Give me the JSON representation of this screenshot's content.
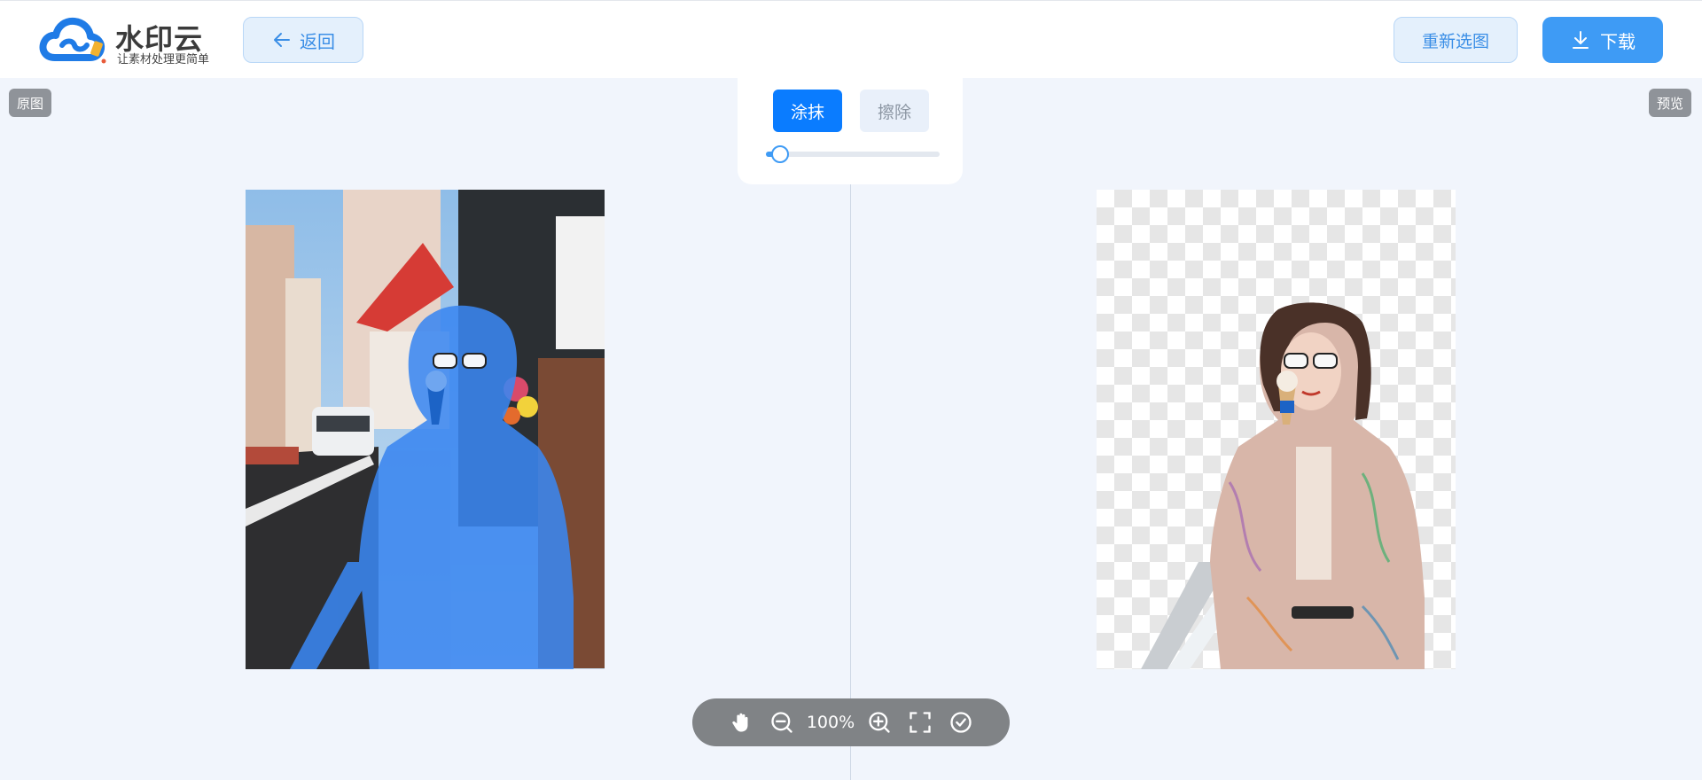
{
  "header": {
    "logo_title": "水印云",
    "logo_subtitle": "让素材处理更简单",
    "back_label": "返回",
    "reselect_label": "重新选图",
    "download_label": "下载"
  },
  "labels": {
    "original": "原图",
    "preview": "预览"
  },
  "tools": {
    "paint_label": "涂抹",
    "erase_label": "擦除",
    "brush_size_fraction": 0.05
  },
  "zoom": {
    "level": "100%"
  },
  "colors": {
    "accent": "#3e9bf5",
    "paint_active": "#0a7cff",
    "mask_blue": "#3a86f0"
  },
  "icons": [
    "arrow-left-icon",
    "download-icon",
    "hand-icon",
    "zoom-out-icon",
    "zoom-in-icon",
    "fit-screen-icon",
    "confirm-icon"
  ]
}
